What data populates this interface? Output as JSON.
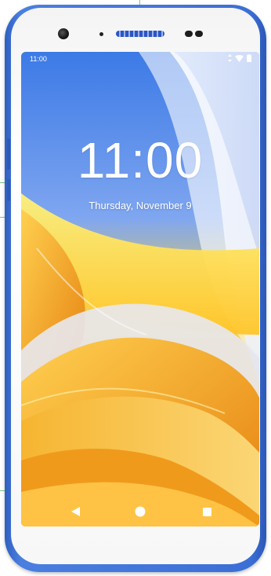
{
  "status_bar": {
    "time": "11:00",
    "icons": [
      "data-activity-icon",
      "wifi-icon",
      "battery-icon"
    ]
  },
  "lock_screen": {
    "clock": "11:00",
    "date": "Thursday, November 9"
  },
  "navigation": {
    "buttons": [
      "back-icon",
      "home-icon",
      "recents-icon"
    ]
  },
  "colors": {
    "device_frame": "#3b6fd6",
    "wallpaper_primary": "#f5a623",
    "wallpaper_sky": "#3d7be8"
  }
}
